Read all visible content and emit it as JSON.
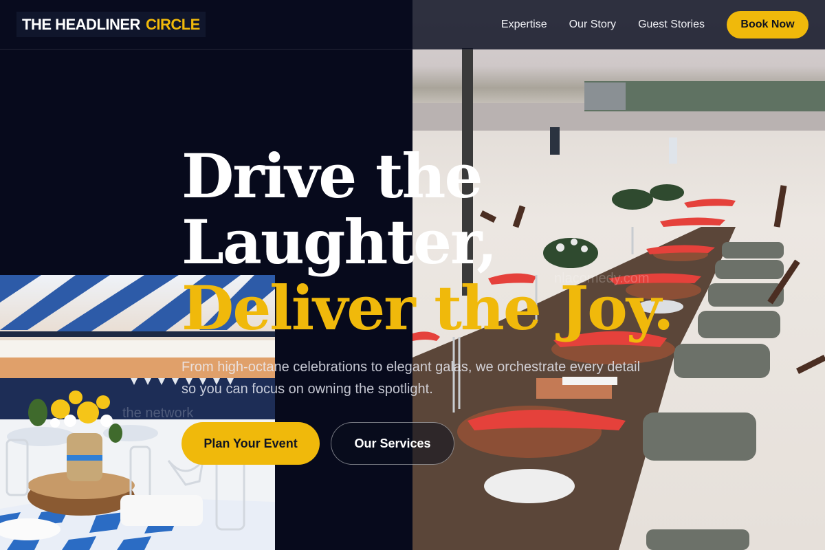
{
  "brand": {
    "name_white": "THE HEADLINER",
    "name_accent": "CIRCLE"
  },
  "nav": {
    "links": [
      "Expertise",
      "Our Story",
      "Guest Stories"
    ],
    "cta": "Book Now"
  },
  "hero": {
    "line1": "Drive the",
    "line2": "Laughter,",
    "line3": "Deliver the Joy.",
    "subtitle": "From high-octane celebrations to elegant galas, we orchestrate every detail so you can focus on owning the spotlight.",
    "primary_button": "Plan Your Event",
    "secondary_button": "Our Services"
  },
  "watermarks": [
    "nlacomedy.com",
    "the network"
  ],
  "colors": {
    "accent": "#f0b90b",
    "background": "#070a1c",
    "text": "#ffffff"
  }
}
